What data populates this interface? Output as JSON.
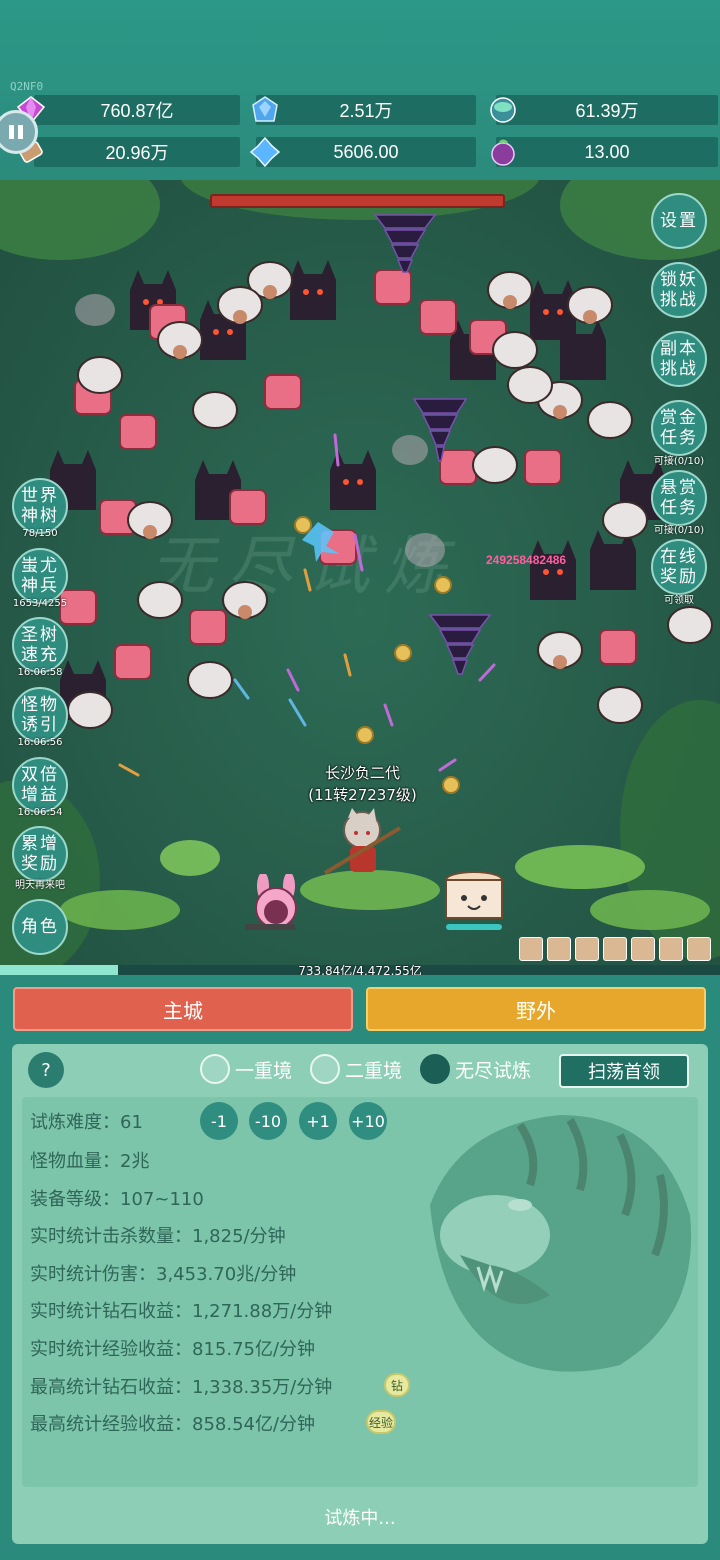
{
  "tag": "Q2NF0",
  "resources": [
    {
      "icon": "purple-gem-icon",
      "value": "760.87亿"
    },
    {
      "icon": "blue-crystal-icon",
      "value": "2.51万"
    },
    {
      "icon": "green-orb-icon",
      "value": "61.39万"
    },
    {
      "icon": "scroll-icon",
      "value": "20.96万"
    },
    {
      "icon": "ice-crystal-icon",
      "value": "5606.00"
    },
    {
      "icon": "purple-fruit-icon",
      "value": "13.00"
    }
  ],
  "battle": {
    "damage_popup": "249258482486",
    "hero_name": "长沙负二代",
    "hero_level": "(11转27237级)",
    "exp_text": "733.84亿/4,472.55亿",
    "exp_progress": 0.164
  },
  "right_menu": [
    {
      "label": "设置",
      "sub": ""
    },
    {
      "label": "锁妖挑战",
      "sub": ""
    },
    {
      "label": "副本挑战",
      "sub": ""
    },
    {
      "label": "赏金任务",
      "sub": "可接(0/10)"
    },
    {
      "label": "悬赏任务",
      "sub": "可接(0/10)"
    },
    {
      "label": "在线奖励",
      "sub": "可领取"
    }
  ],
  "left_menu": [
    {
      "label": "世界神树",
      "sub": "78/150"
    },
    {
      "label": "蚩尤神兵",
      "sub": "1653/4255"
    },
    {
      "label": "圣树速充",
      "sub": "16:06:58"
    },
    {
      "label": "怪物诱引",
      "sub": "16:06:56"
    },
    {
      "label": "双倍增益",
      "sub": "16:06:54"
    },
    {
      "label": "累增奖励",
      "sub": "明天再来吧"
    },
    {
      "label": "角色",
      "sub": ""
    }
  ],
  "tabs": {
    "city": "主城",
    "field": "野外"
  },
  "panel": {
    "help": "?",
    "modes": [
      "一重境",
      "二重境",
      "无尽试炼"
    ],
    "active_mode": 2,
    "sweep": "扫荡首领",
    "difficulty_label": "试炼难度：61",
    "steps": [
      "-1",
      "-10",
      "+1",
      "+10"
    ],
    "stats": [
      "怪物血量：2兆",
      "装备等级：107~110",
      "实时统计击杀数量：1,825/分钟",
      "实时统计伤害：3,453.70兆/分钟",
      "实时统计钻石收益：1,271.88万/分钟",
      "实时统计经验收益：815.75亿/分钟",
      "最高统计钻石收益：1,338.35万/分钟",
      "最高统计经验收益：858.54亿/分钟"
    ],
    "badge_diamond": "钻",
    "badge_exp": "经验",
    "status": "试炼中..."
  }
}
